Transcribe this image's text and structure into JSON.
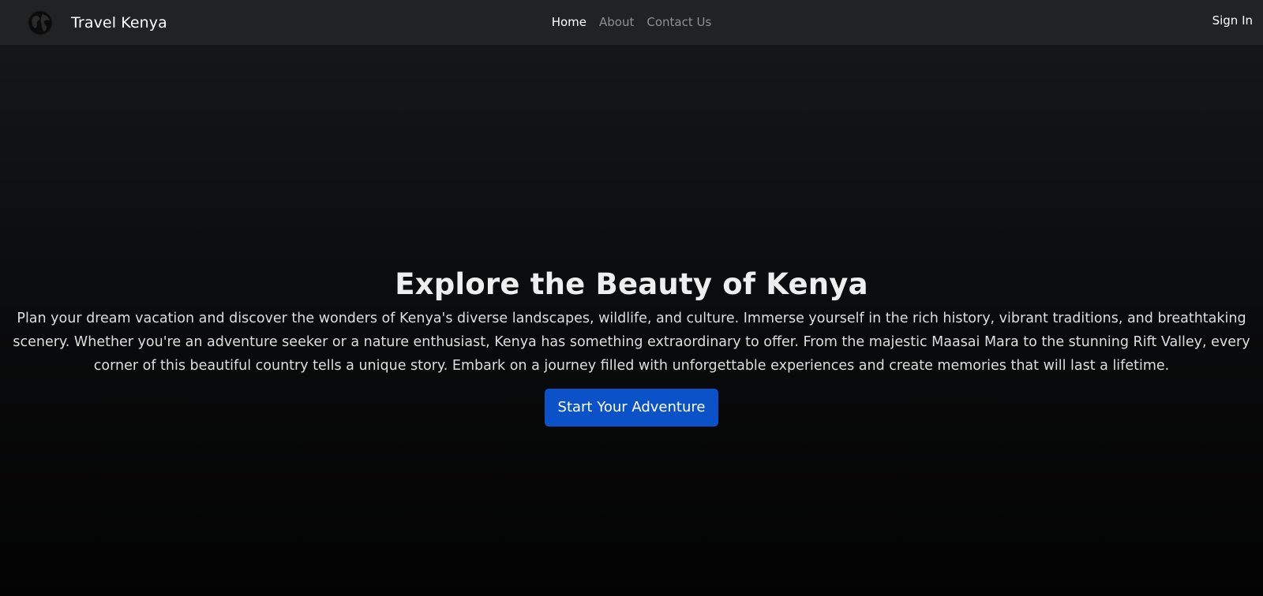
{
  "navbar": {
    "brand_icon": "globe-icon",
    "brand_name": "Travel Kenya",
    "links": [
      {
        "label": "Home",
        "active": true
      },
      {
        "label": "About",
        "active": false
      },
      {
        "label": "Contact Us",
        "active": false
      }
    ],
    "signin_label": "Sign In"
  },
  "hero": {
    "title": "Explore the Beauty of Kenya",
    "description": "Plan your dream vacation and discover the wonders of Kenya's diverse landscapes, wildlife, and culture. Immerse yourself in the rich history, vibrant traditions, and breathtaking scenery. Whether you're an adventure seeker or a nature enthusiast, Kenya has something extraordinary to offer. From the majestic Maasai Mara to the stunning Rift Valley, every corner of this beautiful country tells a unique story. Embark on a journey filled with unforgettable experiences and create memories that will last a lifetime.",
    "cta_label": "Start Your Adventure"
  },
  "colors": {
    "navbar_bg": "#212224",
    "accent": "#0b52c9",
    "text": "#eeeeee",
    "muted_link": "#8e8f91"
  }
}
